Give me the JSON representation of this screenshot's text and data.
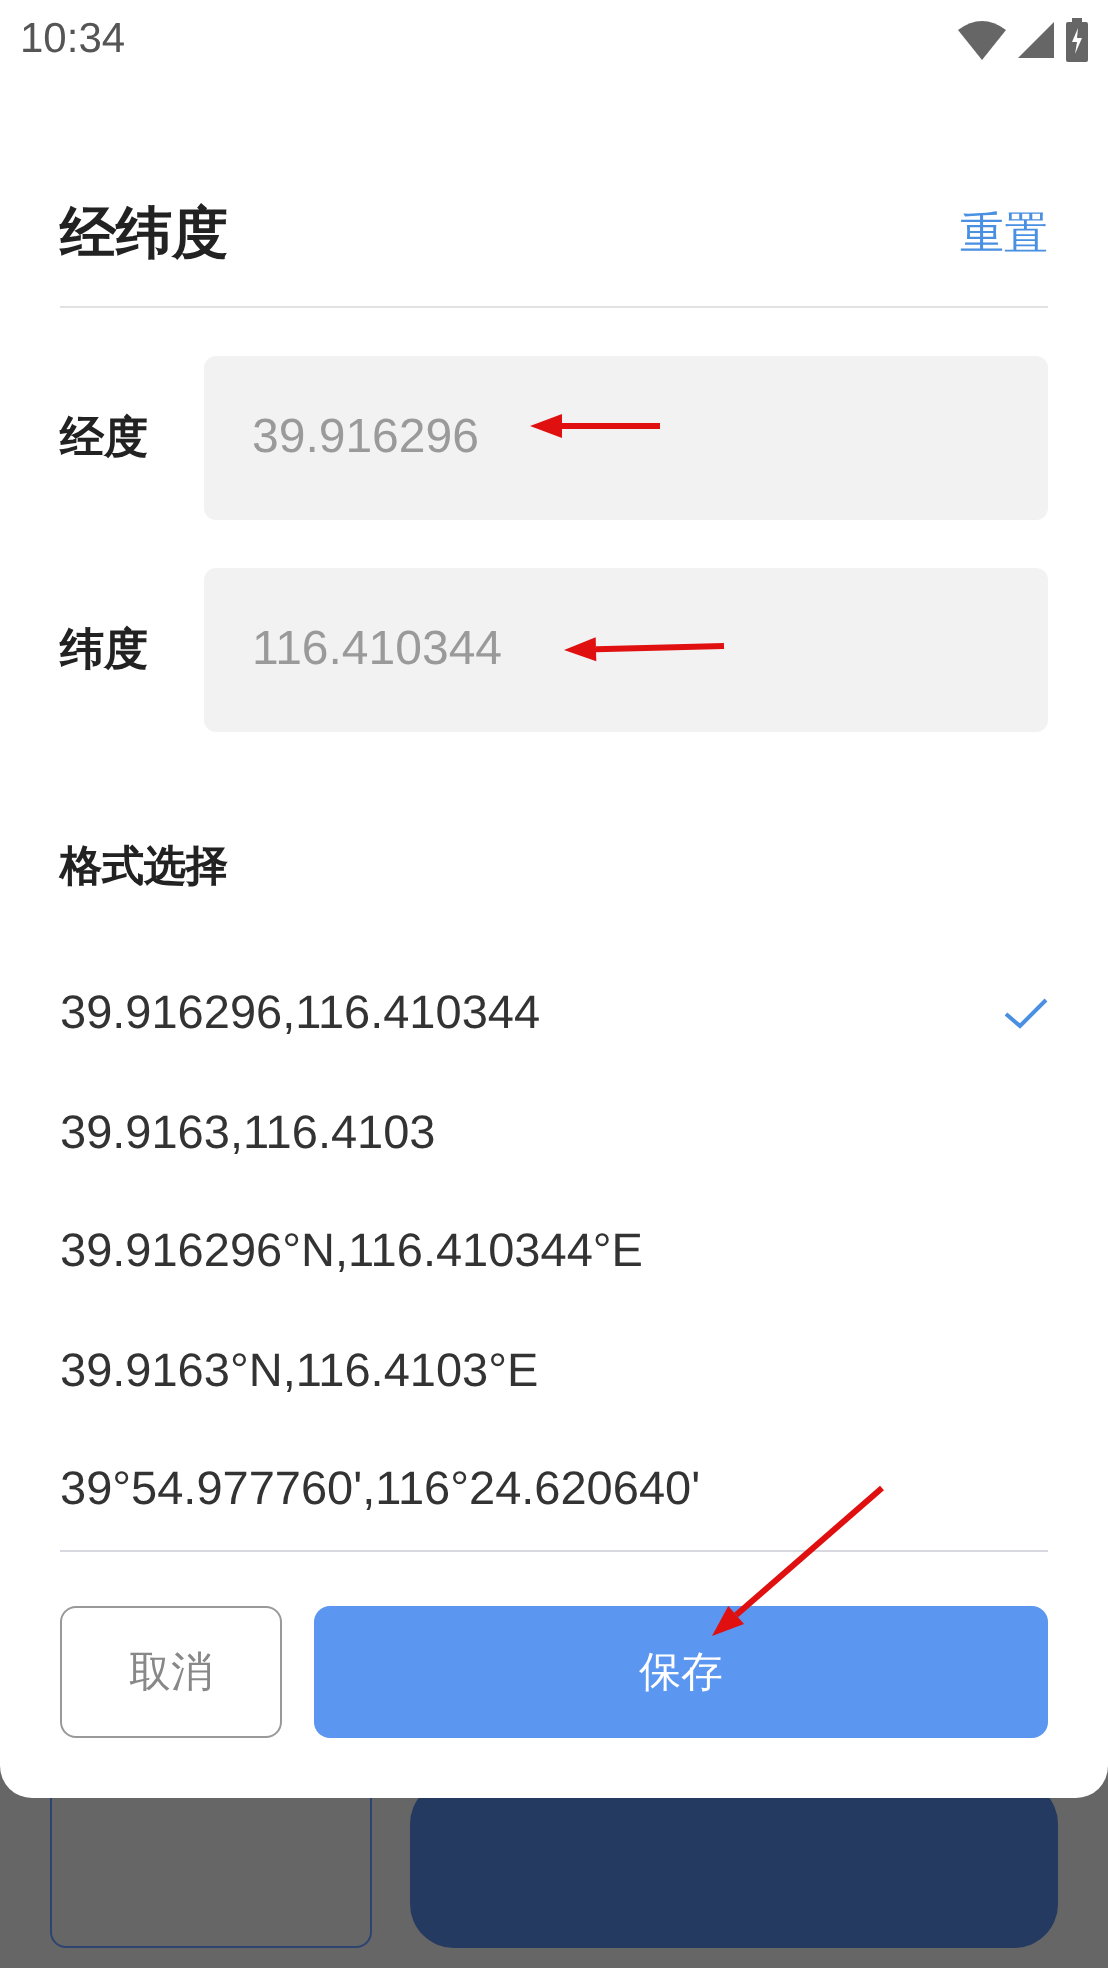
{
  "status_bar": {
    "time": "10:34"
  },
  "dialog": {
    "title": "经纬度",
    "reset": "重置",
    "fields": [
      {
        "label": "经度",
        "placeholder": "39.916296"
      },
      {
        "label": "纬度",
        "placeholder": "116.410344"
      }
    ],
    "format_heading": "格式选择",
    "formats": [
      {
        "label": "39.916296,116.410344",
        "selected": true
      },
      {
        "label": "39.9163,116.4103",
        "selected": false
      },
      {
        "label": "39.916296°N,116.410344°E",
        "selected": false
      },
      {
        "label": "39.9163°N,116.4103°E",
        "selected": false
      },
      {
        "label": "39°54.977760',116°24.620640'",
        "selected": false
      }
    ],
    "buttons": [
      {
        "label": "取消",
        "kind": "secondary"
      },
      {
        "label": "保存",
        "kind": "primary"
      }
    ]
  }
}
